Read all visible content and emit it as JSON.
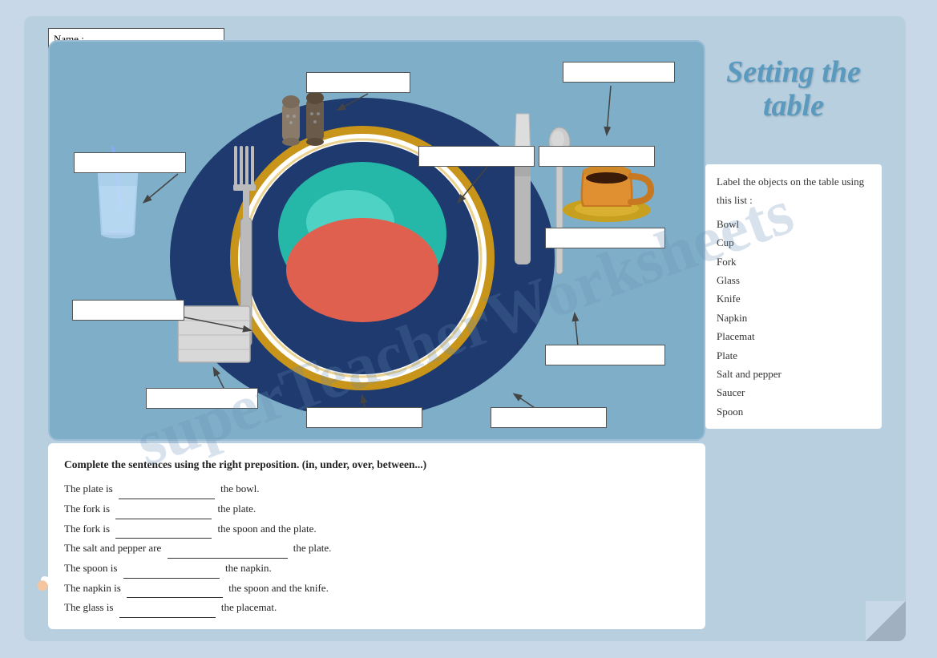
{
  "page": {
    "title": "Setting the table",
    "name_label": "Name :"
  },
  "word_list": {
    "instructions": "Label the objects on the table using this list :",
    "items": [
      "Bowl",
      "Cup",
      "Fork",
      "Glass",
      "Knife",
      "Napkin",
      "Placemat",
      "Plate",
      "Salt and pepper",
      "Saucer",
      "Spoon"
    ]
  },
  "labels": {
    "top_center": "",
    "top_right": "",
    "upper_left": "",
    "upper_center": "",
    "upper_cup": "",
    "mid_right_top": "",
    "left_mid": "",
    "mid_right_bottom": "",
    "bottom_left": "",
    "bottom_center": "",
    "bottom_right": ""
  },
  "sentences": {
    "instructions": "Complete the sentences using the right preposition. (in, under, over, between...)",
    "lines": [
      {
        "before": "The plate is",
        "blank": true,
        "after": "the bowl."
      },
      {
        "before": "The fork is",
        "blank": true,
        "after": "the plate."
      },
      {
        "before": "The fork is",
        "blank": true,
        "after": "the spoon and the plate."
      },
      {
        "before": "The salt and pepper are",
        "blank": true,
        "after": "the plate."
      },
      {
        "before": "The spoon is",
        "blank": true,
        "after": "the napkin."
      },
      {
        "before": "The napkin is",
        "blank": true,
        "after": "the spoon and the knife."
      },
      {
        "before": "The glass is",
        "blank": true,
        "after": "the placemat."
      }
    ]
  }
}
